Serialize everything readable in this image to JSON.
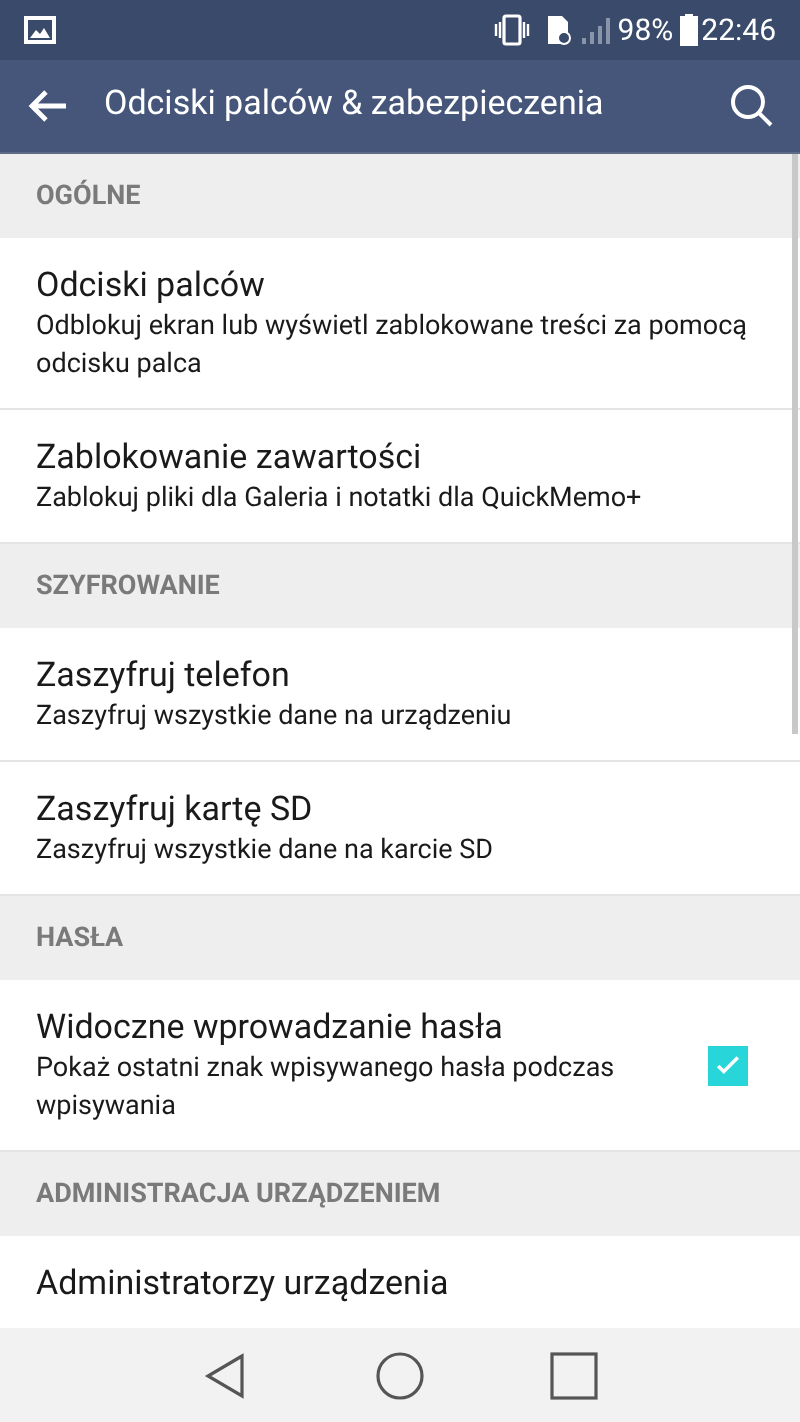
{
  "status_bar": {
    "battery": "98%",
    "time": "22:46"
  },
  "app_bar": {
    "title": "Odciski palców & zabezpieczenia"
  },
  "sections": [
    {
      "header": "OGÓLNE",
      "items": [
        {
          "kind": "text",
          "title": "Odciski palców",
          "subtitle": "Odblokuj ekran lub wyświetl zablokowane treści za pomocą odcisku palca"
        },
        {
          "kind": "text",
          "title": "Zablokowanie zawartości",
          "subtitle": "Zablokuj pliki dla Galeria i notatki dla QuickMemo+"
        }
      ]
    },
    {
      "header": "SZYFROWANIE",
      "items": [
        {
          "kind": "text",
          "title": "Zaszyfruj telefon",
          "subtitle": "Zaszyfruj wszystkie dane na urządzeniu"
        },
        {
          "kind": "text",
          "title": "Zaszyfruj kartę SD",
          "subtitle": "Zaszyfruj wszystkie dane na karcie SD"
        }
      ]
    },
    {
      "header": "HASŁA",
      "items": [
        {
          "kind": "checkbox",
          "title": "Widoczne wprowadzanie hasła",
          "subtitle": "Pokaż ostatni znak wpisywanego hasła podczas wpisywania",
          "checked": true
        }
      ]
    },
    {
      "header": "ADMINISTRACJA URZĄDZENIEM",
      "items": [
        {
          "kind": "text",
          "title": "Administratorzy urządzenia"
        }
      ]
    }
  ]
}
